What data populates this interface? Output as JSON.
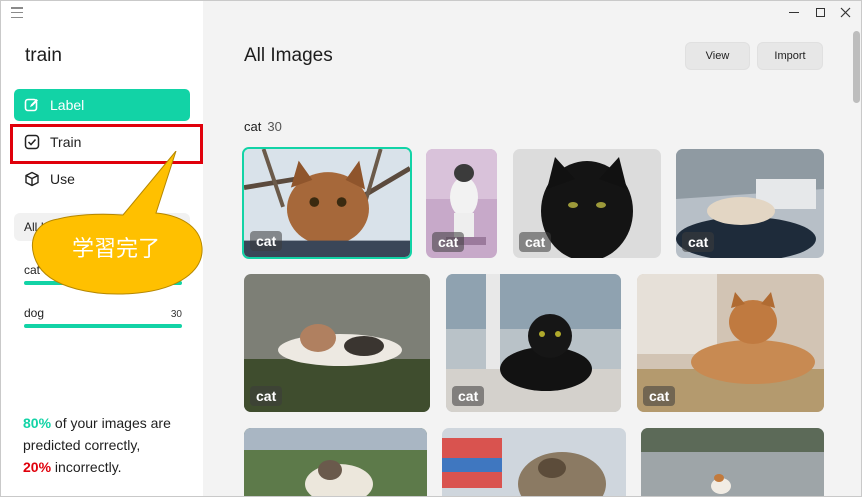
{
  "app": {
    "title": "train"
  },
  "sidebar": {
    "items": [
      {
        "label": "Label",
        "icon": "edit-icon"
      },
      {
        "label": "Train",
        "icon": "checkbox-icon"
      },
      {
        "label": "Use",
        "icon": "cube-icon"
      }
    ],
    "filter_label": "All I",
    "categories": [
      {
        "name": "cat",
        "count": "",
        "progress": 1.0
      },
      {
        "name": "dog",
        "count": "30",
        "progress": 1.0
      }
    ],
    "stats": {
      "correct_pct": "80%",
      "correct_text": " of your images are predicted correctly,",
      "incorrect_pct": "20%",
      "incorrect_text": " incorrectly."
    }
  },
  "callout": {
    "text": "学習完了",
    "color": "#ffc000"
  },
  "main": {
    "title": "All Images",
    "view_button": "View",
    "import_button": "Import",
    "section": {
      "name": "cat",
      "count": "30"
    },
    "tiles": [
      {
        "tag": "cat",
        "selected": true
      },
      {
        "tag": "cat"
      },
      {
        "tag": "cat"
      },
      {
        "tag": "cat"
      },
      {
        "tag": "cat"
      },
      {
        "tag": "cat"
      },
      {
        "tag": "cat"
      },
      {
        "tag": ""
      },
      {
        "tag": ""
      },
      {
        "tag": ""
      }
    ]
  },
  "colors": {
    "accent": "#12d3a6",
    "highlight": "#e0000b"
  }
}
